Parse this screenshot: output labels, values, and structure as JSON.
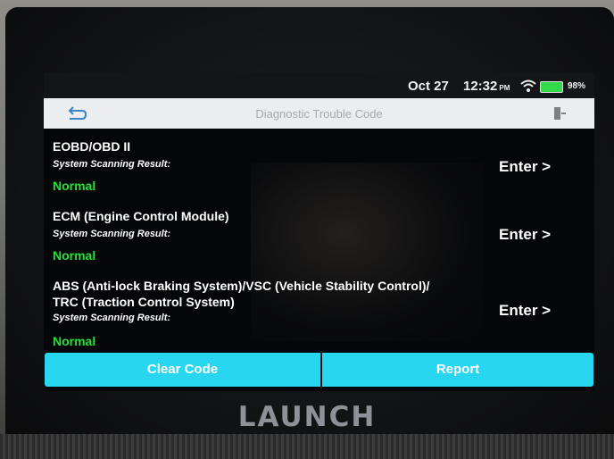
{
  "device": {
    "brand": "LAUNCH"
  },
  "status_bar": {
    "date": "Oct 27",
    "time": "12:32",
    "ampm": "PM",
    "battery": "98%",
    "icons": [
      "wifi-icon",
      "battery-icon"
    ]
  },
  "header": {
    "title": "Diagnostic Trouble Code",
    "back_icon": "back-arrow-icon",
    "exit_icon": "exit-icon"
  },
  "systems": [
    {
      "name": "EOBD/OBD II",
      "label": "System Scanning Result:",
      "result": "Normal",
      "enter": "Enter >"
    },
    {
      "name": "ECM (Engine Control Module)",
      "label": "System Scanning Result:",
      "result": "Normal",
      "enter": "Enter >"
    },
    {
      "name_line1": "ABS (Anti-lock Braking System)/VSC (Vehicle Stability Control)/",
      "name_line2": "TRC (Traction Control System)",
      "label": "System Scanning Result:",
      "result": "Normal",
      "enter": "Enter >"
    }
  ],
  "actions": {
    "clear": "Clear Code",
    "report": "Report"
  },
  "colors": {
    "accent": "#29d6f0",
    "normal": "#27e039",
    "screen_bg": "#050608",
    "titlebar_bg": "#ecedee"
  }
}
